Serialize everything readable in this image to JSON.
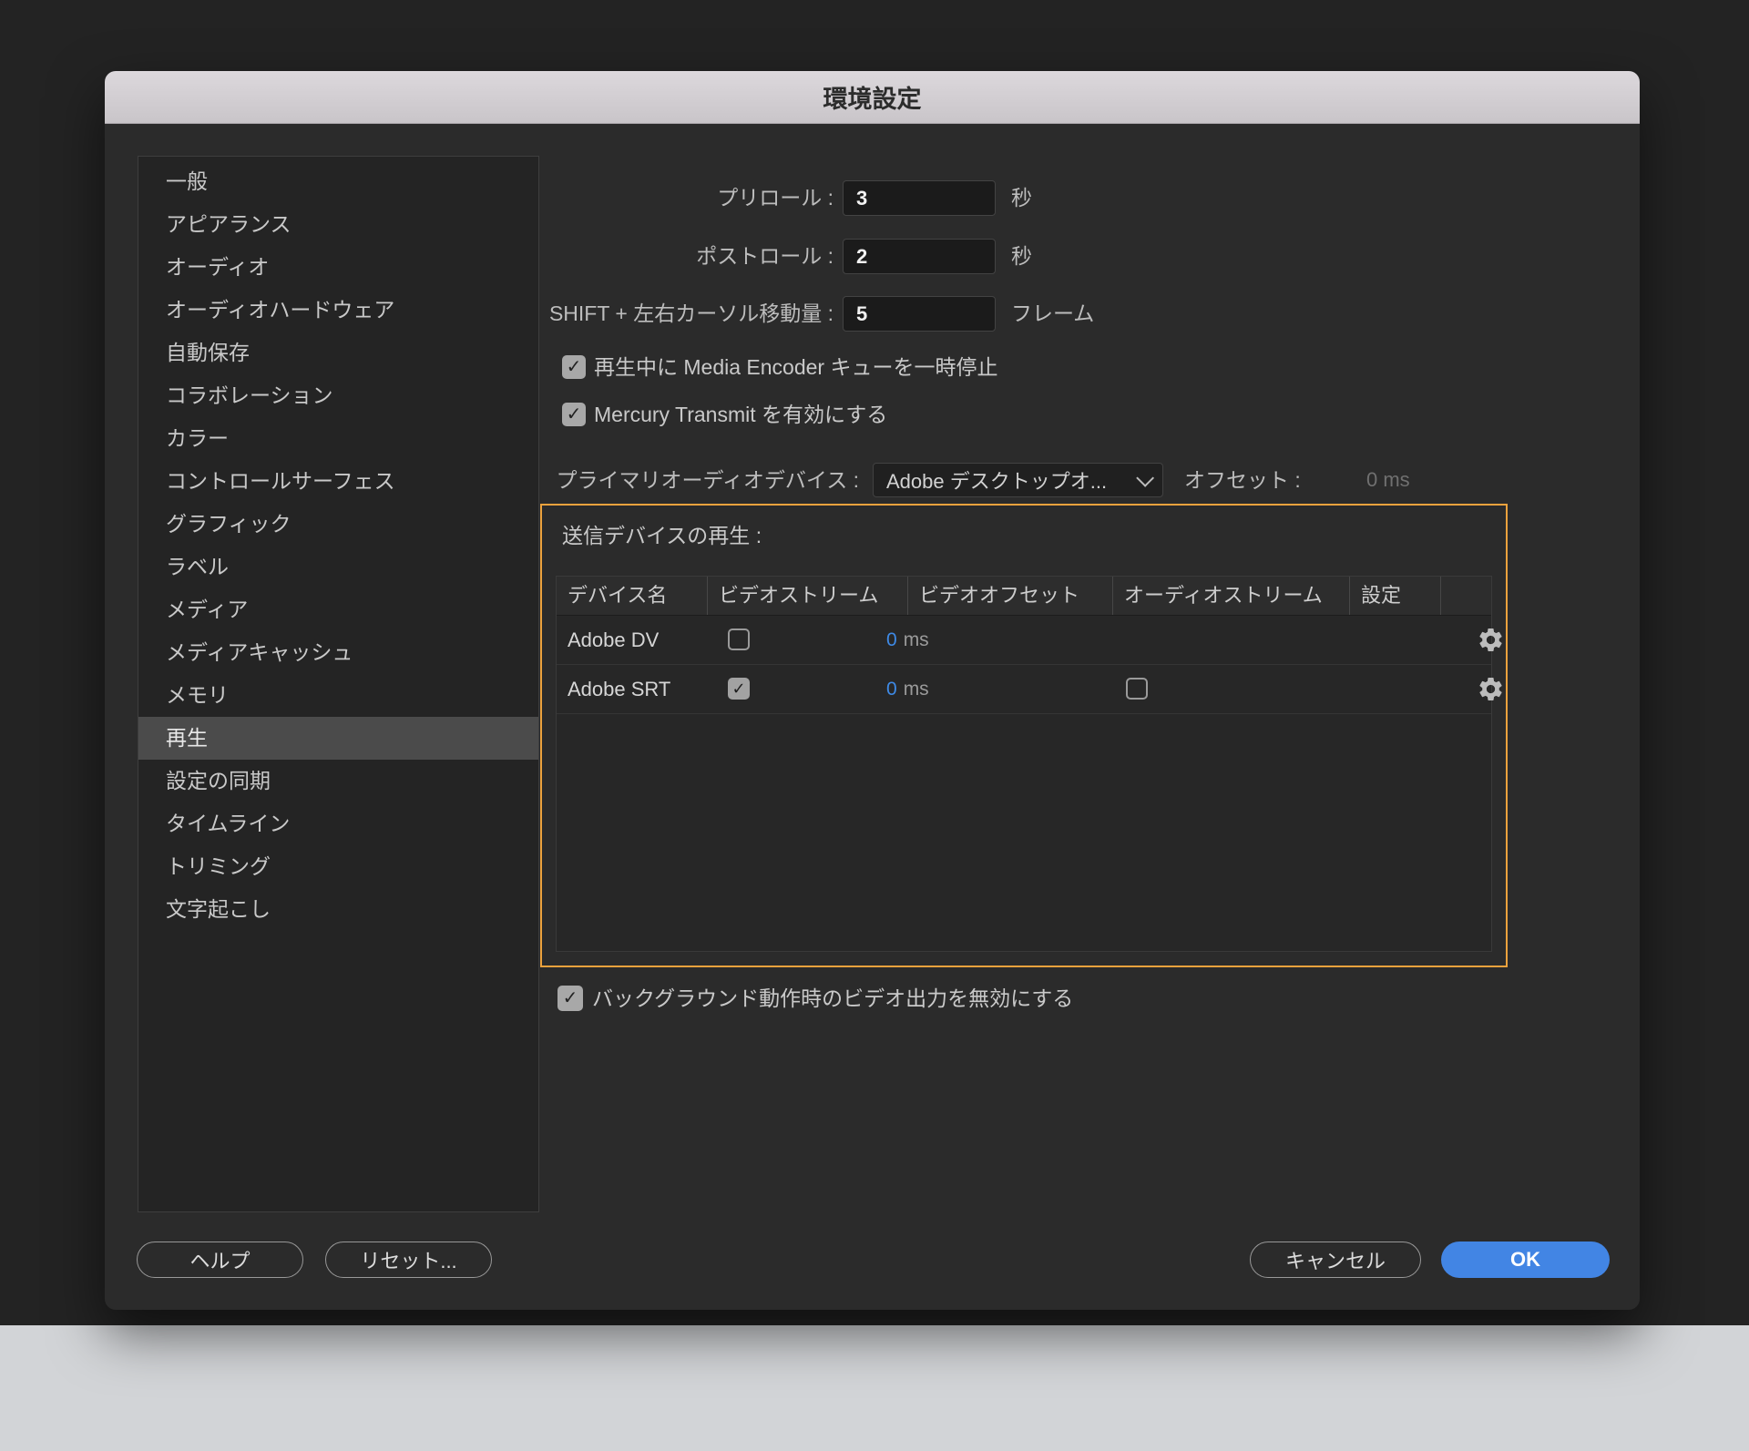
{
  "window": {
    "title": "環境設定"
  },
  "sidebar": {
    "items": [
      {
        "label": "一般",
        "selected": false
      },
      {
        "label": "アピアランス",
        "selected": false
      },
      {
        "label": "オーディオ",
        "selected": false
      },
      {
        "label": "オーディオハードウェア",
        "selected": false
      },
      {
        "label": "自動保存",
        "selected": false
      },
      {
        "label": "コラボレーション",
        "selected": false
      },
      {
        "label": "カラー",
        "selected": false
      },
      {
        "label": "コントロールサーフェス",
        "selected": false
      },
      {
        "label": "グラフィック",
        "selected": false
      },
      {
        "label": "ラベル",
        "selected": false
      },
      {
        "label": "メディア",
        "selected": false
      },
      {
        "label": "メディアキャッシュ",
        "selected": false
      },
      {
        "label": "メモリ",
        "selected": false
      },
      {
        "label": "再生",
        "selected": true
      },
      {
        "label": "設定の同期",
        "selected": false
      },
      {
        "label": "タイムライン",
        "selected": false
      },
      {
        "label": "トリミング",
        "selected": false
      },
      {
        "label": "文字起こし",
        "selected": false
      }
    ]
  },
  "form": {
    "preroll": {
      "label": "プリロール :",
      "value": "3",
      "unit": "秒"
    },
    "postroll": {
      "label": "ポストロール :",
      "value": "2",
      "unit": "秒"
    },
    "shift_cursor": {
      "label": "SHIFT + 左右カーソル移動量 :",
      "value": "5",
      "unit": "フレーム"
    },
    "pause_media_encoder": {
      "label": "再生中に Media Encoder キューを一時停止",
      "checked": true
    },
    "mercury_transmit": {
      "label": "Mercury Transmit を有効にする",
      "checked": true
    },
    "primary_audio_device": {
      "label": "プライマリオーディオデバイス :",
      "value": "Adobe デスクトップオ...",
      "offset_label": "オフセット :",
      "offset_value": "0 ms"
    },
    "disable_background_video": {
      "label": "バックグラウンド動作時のビデオ出力を無効にする",
      "checked": true
    }
  },
  "transmit_section": {
    "title": "送信デバイスの再生 :",
    "columns": {
      "device": "デバイス名",
      "video_stream": "ビデオストリーム",
      "video_offset": "ビデオオフセット",
      "audio_stream": "オーディオストリーム",
      "settings": "設定"
    },
    "rows": [
      {
        "device": "Adobe DV",
        "video_stream_checked": false,
        "offset_value": "0",
        "offset_unit": "ms",
        "has_audio_checkbox": false
      },
      {
        "device": "Adobe SRT",
        "video_stream_checked": true,
        "offset_value": "0",
        "offset_unit": "ms",
        "has_audio_checkbox": true,
        "audio_stream_checked": false
      }
    ]
  },
  "buttons": {
    "help": "ヘルプ",
    "reset": "リセット...",
    "cancel": "キャンセル",
    "ok": "OK"
  },
  "icons": {
    "check": "✓"
  },
  "colors": {
    "accent_orange": "#ECA23D",
    "value_blue": "#3E8AE6",
    "ok_blue": "#4285E4",
    "selected_gray": "#4B4B4B"
  }
}
